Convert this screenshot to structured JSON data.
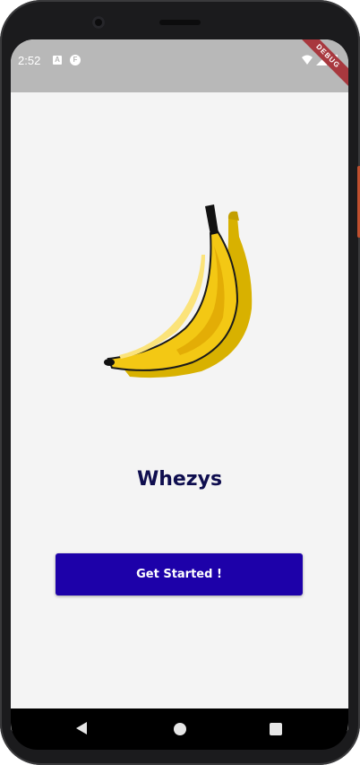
{
  "status_bar": {
    "time": "2:52",
    "icon_a": "A",
    "icon_f": "F",
    "debug_label": "DEBUG"
  },
  "main": {
    "illustration": "banana-illustration",
    "title": "Whezys",
    "cta_label": "Get Started !"
  },
  "nav_bar": {
    "buttons": [
      "back",
      "home",
      "recents"
    ]
  },
  "colors": {
    "background": "#f4f4f4",
    "status_bar": "#b8b8b8",
    "title": "#0f0e4f",
    "button": "#1d01a9",
    "banana": "#f3c814"
  }
}
